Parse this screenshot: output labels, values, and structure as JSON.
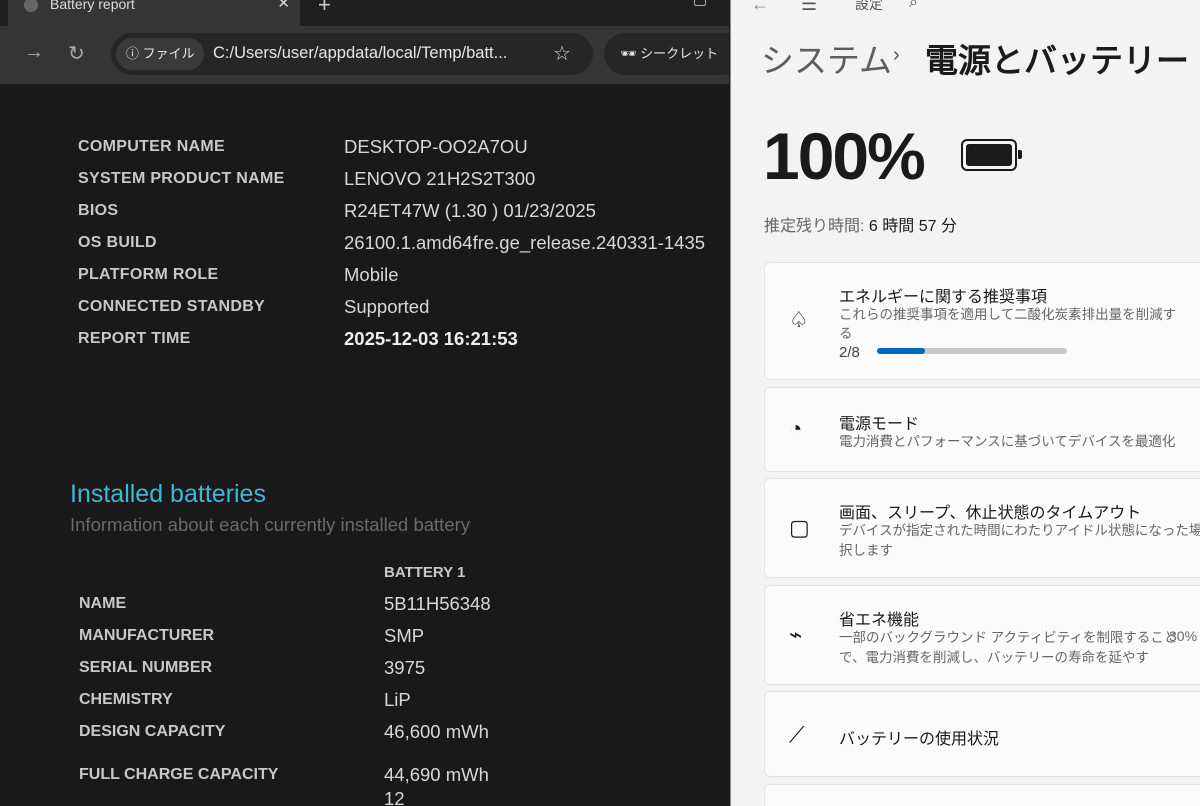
{
  "browser": {
    "tab_title": "Battery report",
    "url_chip": "ファイル",
    "url": "C:/Users/user/appdata/local/Temp/batt...",
    "incognito": "シークレット"
  },
  "report": {
    "system": [
      {
        "label": "COMPUTER NAME",
        "value": "DESKTOP-OO2A7OU"
      },
      {
        "label": "SYSTEM PRODUCT NAME",
        "value": "LENOVO 21H2S2T300"
      },
      {
        "label": "BIOS",
        "value": "R24ET47W (1.30 ) 01/23/2025"
      },
      {
        "label": "OS BUILD",
        "value": "26100.1.amd64fre.ge_release.240331-1435"
      },
      {
        "label": "PLATFORM ROLE",
        "value": "Mobile"
      },
      {
        "label": "CONNECTED STANDBY",
        "value": "Supported"
      },
      {
        "label": "REPORT TIME",
        "value": "2025-12-03  16:21:53"
      }
    ],
    "batteries_heading": "Installed batteries",
    "batteries_sub": "Information about each currently installed battery",
    "battery_column": "BATTERY 1",
    "battery": [
      {
        "label": "NAME",
        "value": "5B11H56348"
      },
      {
        "label": "MANUFACTURER",
        "value": "SMP"
      },
      {
        "label": "SERIAL NUMBER",
        "value": "3975"
      },
      {
        "label": "CHEMISTRY",
        "value": "LiP"
      },
      {
        "label": "DESIGN CAPACITY",
        "value": "46,600 mWh"
      },
      {
        "label": "FULL CHARGE CAPACITY",
        "value": "44,690 mWh"
      }
    ],
    "partial_next": "12"
  },
  "settings": {
    "app_title": "設定",
    "breadcrumb_parent": "システム",
    "breadcrumb_current": "電源とバッテリー",
    "percent": "100%",
    "battery_level": 1.0,
    "remaining_label": "推定残り時間:",
    "remaining_value": "6 時間 57 分",
    "cards": [
      {
        "title": "エネルギーに関する推奨事項",
        "sub": "これらの推奨事項を適用して二酸化炭素排出量を削減する",
        "progress_text": "2/8",
        "progress": 0.25
      },
      {
        "title": "電源モード",
        "sub": "電力消費とパフォーマンスに基づいてデバイスを最適化"
      },
      {
        "title": "画面、スリープ、休止状態のタイムアウト",
        "sub": "デバイスが指定された時間にわたりアイドル状態になった場合の",
        "sub2": "択します"
      },
      {
        "title": "省エネ機能",
        "sub": "一部のバックグラウンド アクティビティを制限すること",
        "sub2": "で、電力消費を削減し、バッテリーの寿命を延やす",
        "value": "30%"
      },
      {
        "title": "バッテリーの使用状況"
      }
    ],
    "accent": "#0067c0"
  }
}
